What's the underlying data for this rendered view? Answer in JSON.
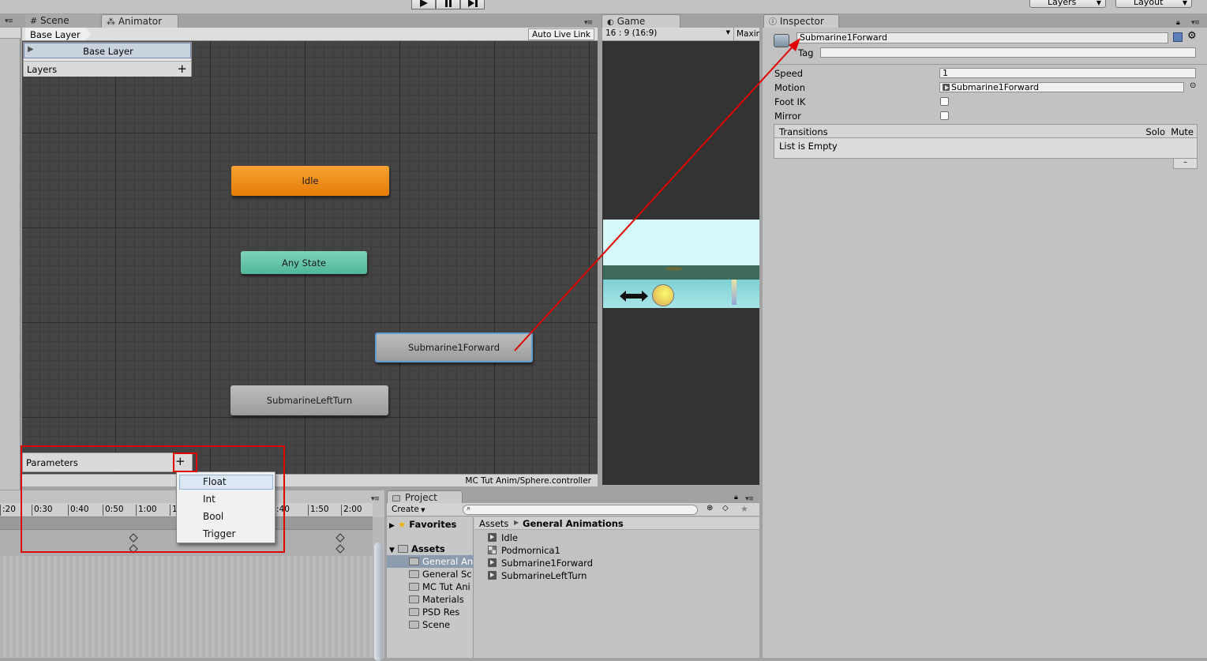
{
  "toolbar": {
    "layers_label": "Layers",
    "layout_label": "Layout"
  },
  "tabs": {
    "scene": "Scene",
    "animator": "Animator",
    "game": "Game",
    "inspector": "Inspector",
    "project": "Project"
  },
  "animator": {
    "breadcrumb": "Base Layer",
    "auto_live_link": "Auto Live Link",
    "layer_item": "Base Layer",
    "layers_header": "Layers",
    "parameters_header": "Parameters",
    "footer_path": "MC Tut Anim/Sphere.controller",
    "states": {
      "idle": "Idle",
      "any_state": "Any State",
      "submarine_forward": "Submarine1Forward",
      "submarine_left": "SubmarineLeftTurn"
    },
    "colors": {
      "idle": "#f08a12",
      "any_state": "#5fc3a9",
      "state": "#a9a9a9",
      "highlight": "#e00000"
    }
  },
  "param_menu": {
    "items": [
      "Float",
      "Int",
      "Bool",
      "Trigger"
    ]
  },
  "timeline": {
    "ticks": [
      ":20",
      "0:30",
      "0:40",
      "0:50",
      "1:00",
      "1:",
      ":40",
      "1:50",
      "2:00"
    ]
  },
  "game": {
    "aspect": "16 : 9 (16:9)",
    "maximize": "Maxin"
  },
  "inspector": {
    "name": "Submarine1Forward",
    "tag_label": "Tag",
    "speed_label": "Speed",
    "speed_value": "1",
    "motion_label": "Motion",
    "motion_value": "Submarine1Forward",
    "foot_ik_label": "Foot IK",
    "mirror_label": "Mirror",
    "transitions_label": "Transitions",
    "solo_label": "Solo",
    "mute_label": "Mute",
    "list_empty": "List is Empty"
  },
  "project": {
    "create_label": "Create",
    "favorites": "Favorites",
    "assets": "Assets",
    "breadcrumb_root": "Assets",
    "breadcrumb_current": "General Animations",
    "folders": [
      "General An",
      "General Sc",
      "MC Tut Ani",
      "Materials",
      "PSD Res",
      "Scene"
    ],
    "files": [
      "Idle",
      "Podmornica1",
      "Submarine1Forward",
      "SubmarineLeftTurn"
    ]
  }
}
